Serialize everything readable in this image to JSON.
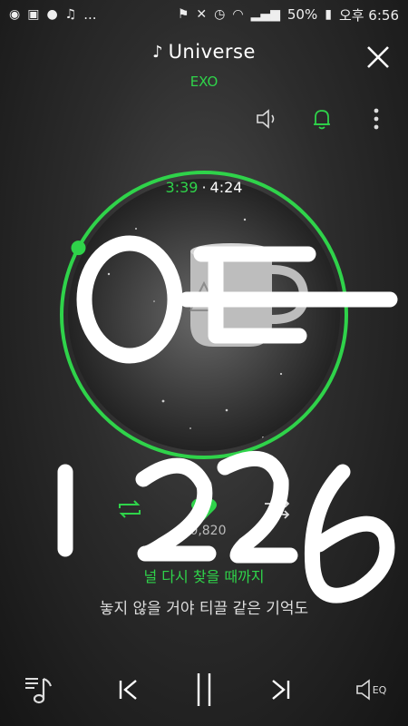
{
  "status_bar": {
    "battery": "50%",
    "time": "오후 6:56",
    "dots": "..."
  },
  "header": {
    "title": "Universe",
    "artist": "EXO"
  },
  "player": {
    "current_time": "3:39",
    "separator": "·",
    "total_time": "4:24",
    "progress": 0.828,
    "like_count": "40,820"
  },
  "lyrics": {
    "current": "널 다시 찾을 때까지",
    "next": "놓지 않을 거야 티끌 같은 기억도"
  },
  "colors": {
    "accent": "#2fd34a",
    "background": "#2c2c2c"
  },
  "icons": {
    "close": "close-icon",
    "volume": "speaker-icon",
    "alarm": "bell-icon",
    "more": "more-vertical-icon",
    "repeat": "repeat-icon",
    "like": "heart-icon",
    "shuffle": "shuffle-icon",
    "playlist": "playlist-icon",
    "prev": "previous-icon",
    "pause": "pause-icon",
    "next": "next-icon",
    "eq": "eq-icon"
  },
  "controls": {
    "eq_label": "EQ"
  }
}
